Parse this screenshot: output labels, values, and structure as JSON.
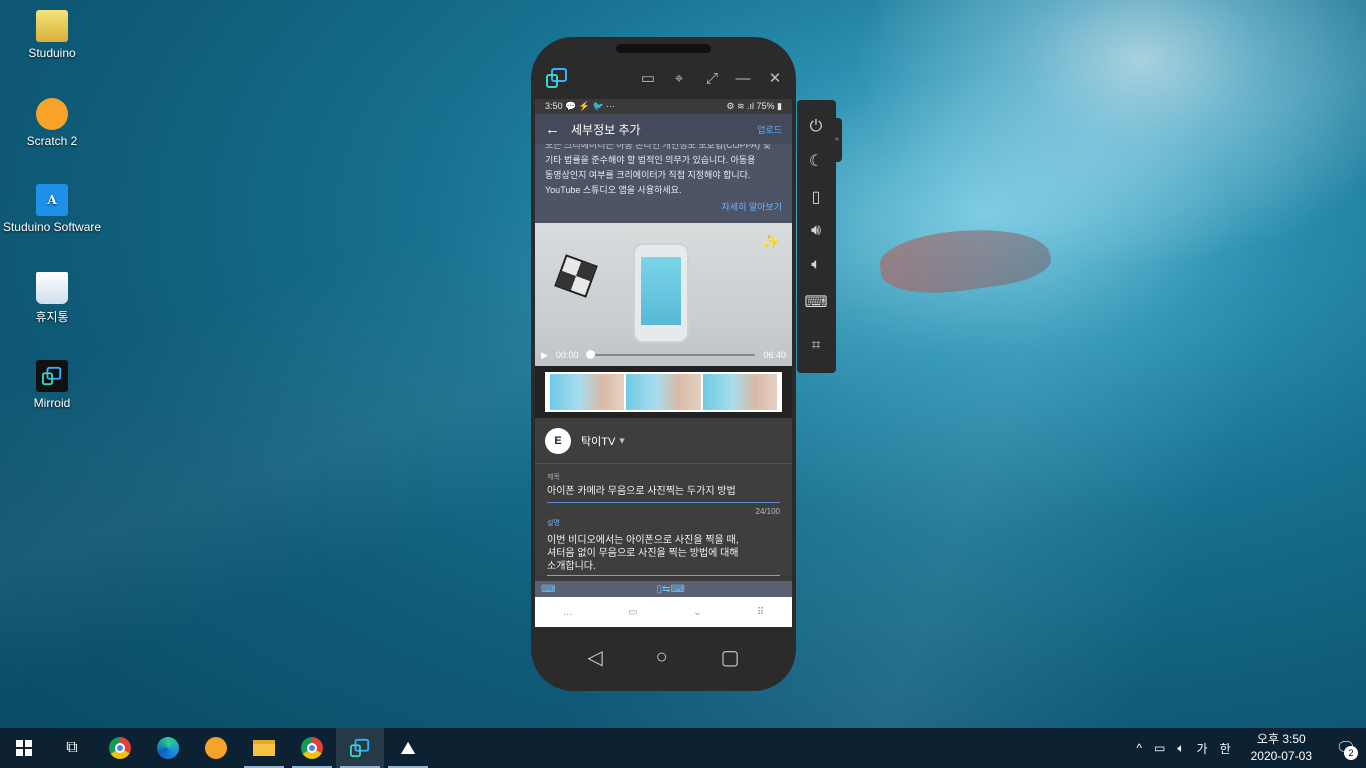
{
  "desktop": {
    "icons": [
      {
        "label": "Studuino"
      },
      {
        "label": "Scratch 2"
      },
      {
        "label": "Studuino Software"
      },
      {
        "label": "휴지통"
      },
      {
        "label": "Mirroid"
      }
    ]
  },
  "mirroid_window": {
    "toolbar_icons": [
      "mirroid-logo-icon",
      "chat-icon",
      "pin-icon",
      "expand-icon",
      "minimize-icon",
      "close-icon"
    ]
  },
  "phone": {
    "status": {
      "time": "3:50",
      "notif_icons": "💬 ⚡ 🐦 ···",
      "right": "⚙ ≋ .ıl 75% ▮"
    },
    "appbar": {
      "title": "세부정보 추가",
      "action": "업로드"
    },
    "notice": {
      "line1": "모든 크리에이터는 아동 온라인 개인정보 보호법(COPPA) 및",
      "line2": "기타 법률을 준수해야 할 법적인 의무가 있습니다. 아동용",
      "line3": "동영상인지 여부를 크리에이터가 직접 지정해야 합니다.",
      "line4": "YouTube 스튜디오 앱을 사용하세요.",
      "more": "자세히 알아보기"
    },
    "video": {
      "current_time": "00:00",
      "duration": "06:40",
      "progress": 0.0
    },
    "channel": {
      "avatar_letter": "E",
      "name": "탁이TV",
      "dropdown": "▾"
    },
    "title_field": {
      "label": "제목",
      "value": "아이폰 카메라 무음으로 사진찍는 두가지 방법",
      "counter": "24/100"
    },
    "desc_field": {
      "label": "설명",
      "line1": "이번 비디오에서는 아이폰으로 사진을 찍을 때,",
      "line2": "셔터음 없이 무음으로 사진을 찍는 방법에 대해",
      "line3": "소개합니다."
    }
  },
  "taskbar": {
    "clock_time": "오후 3:50",
    "clock_date": "2020-07-03",
    "ime": "가",
    "lang": "한",
    "notif_count": "2"
  }
}
